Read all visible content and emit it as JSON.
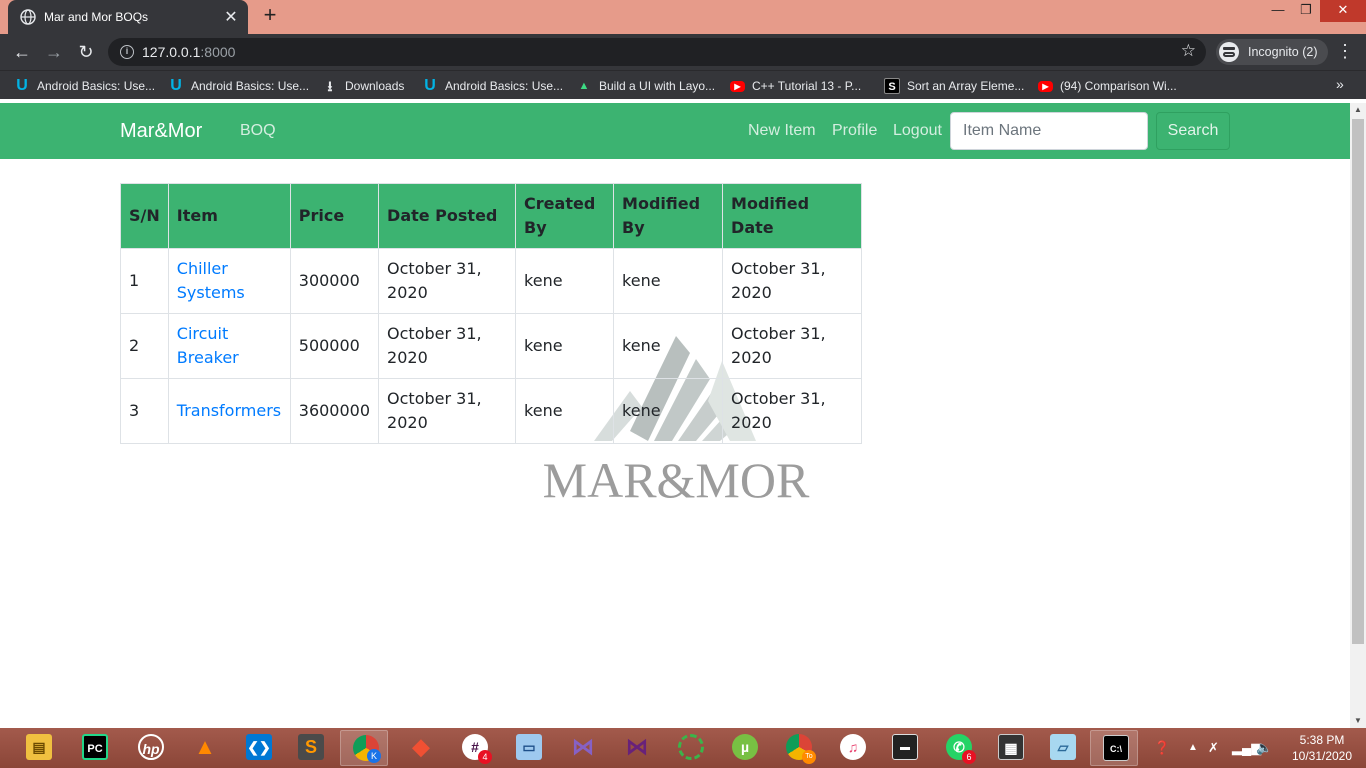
{
  "browser": {
    "tab_title": "Mar and Mor BOQs",
    "new_tab": "+",
    "url_host": "127.0.0.1",
    "url_port": ":8000",
    "incognito_label": "Incognito (2)",
    "bookmarks": [
      {
        "label": "Android Basics: Use...",
        "icon": "udacity-icon"
      },
      {
        "label": "Android Basics: Use...",
        "icon": "udacity-icon"
      },
      {
        "label": "Downloads",
        "icon": "download-icon"
      },
      {
        "label": "Android Basics: Use...",
        "icon": "udacity-icon"
      },
      {
        "label": "Build a UI with Layo...",
        "icon": "android-icon"
      },
      {
        "label": "C++ Tutorial 13 - P...",
        "icon": "youtube-icon"
      },
      {
        "label": "Sort an Array Eleme...",
        "icon": "studytonight-icon"
      },
      {
        "label": "(94) Comparison Wi...",
        "icon": "youtube-icon"
      }
    ]
  },
  "navbar": {
    "brand": "Mar&Mor",
    "boq_link": "BOQ",
    "new_item": "New Item",
    "profile": "Profile",
    "logout": "Logout",
    "search_placeholder": "Item Name",
    "search_button": "Search",
    "color": "#3cb371"
  },
  "table": {
    "headers": [
      "S/N",
      "Item",
      "Price",
      "Date Posted",
      "Created By",
      "Modified By",
      "Modified Date"
    ],
    "rows": [
      {
        "sn": "1",
        "item": "Chiller Systems",
        "price": "300000",
        "date_posted": "October 31, 2020",
        "created_by": "kene",
        "modified_by": "kene",
        "modified_date": "October 31, 2020"
      },
      {
        "sn": "2",
        "item": "Circuit Breaker",
        "price": "500000",
        "date_posted": "October 31, 2020",
        "created_by": "kene",
        "modified_by": "kene",
        "modified_date": "October 31, 2020"
      },
      {
        "sn": "3",
        "item": "Transformers",
        "price": "3600000",
        "date_posted": "October 31, 2020",
        "created_by": "kene",
        "modified_by": "kene",
        "modified_date": "October 31, 2020"
      }
    ]
  },
  "watermark": {
    "text": "MAR&MOR"
  },
  "taskbar": {
    "apps": [
      "file-explorer-icon",
      "pycharm-icon",
      "hp-icon",
      "vlc-icon",
      "vscode-icon",
      "sublime-text-icon",
      "chrome-icon",
      "git-icon",
      "slack-icon",
      "remote-desktop-icon",
      "visual-studio-icon",
      "visual-studio-icon",
      "refresh-app-icon",
      "utorrent-icon",
      "chrome-icon",
      "itunes-icon",
      "terminal-icon",
      "whatsapp-icon",
      "app-icon",
      "notepad-icon",
      "cmd-icon"
    ],
    "slack_badge": "4",
    "whatsapp_badge": "6",
    "chrome_k_badge": "K",
    "chrome_to_badge": "To",
    "time": "5:38 PM",
    "date": "10/31/2020"
  }
}
